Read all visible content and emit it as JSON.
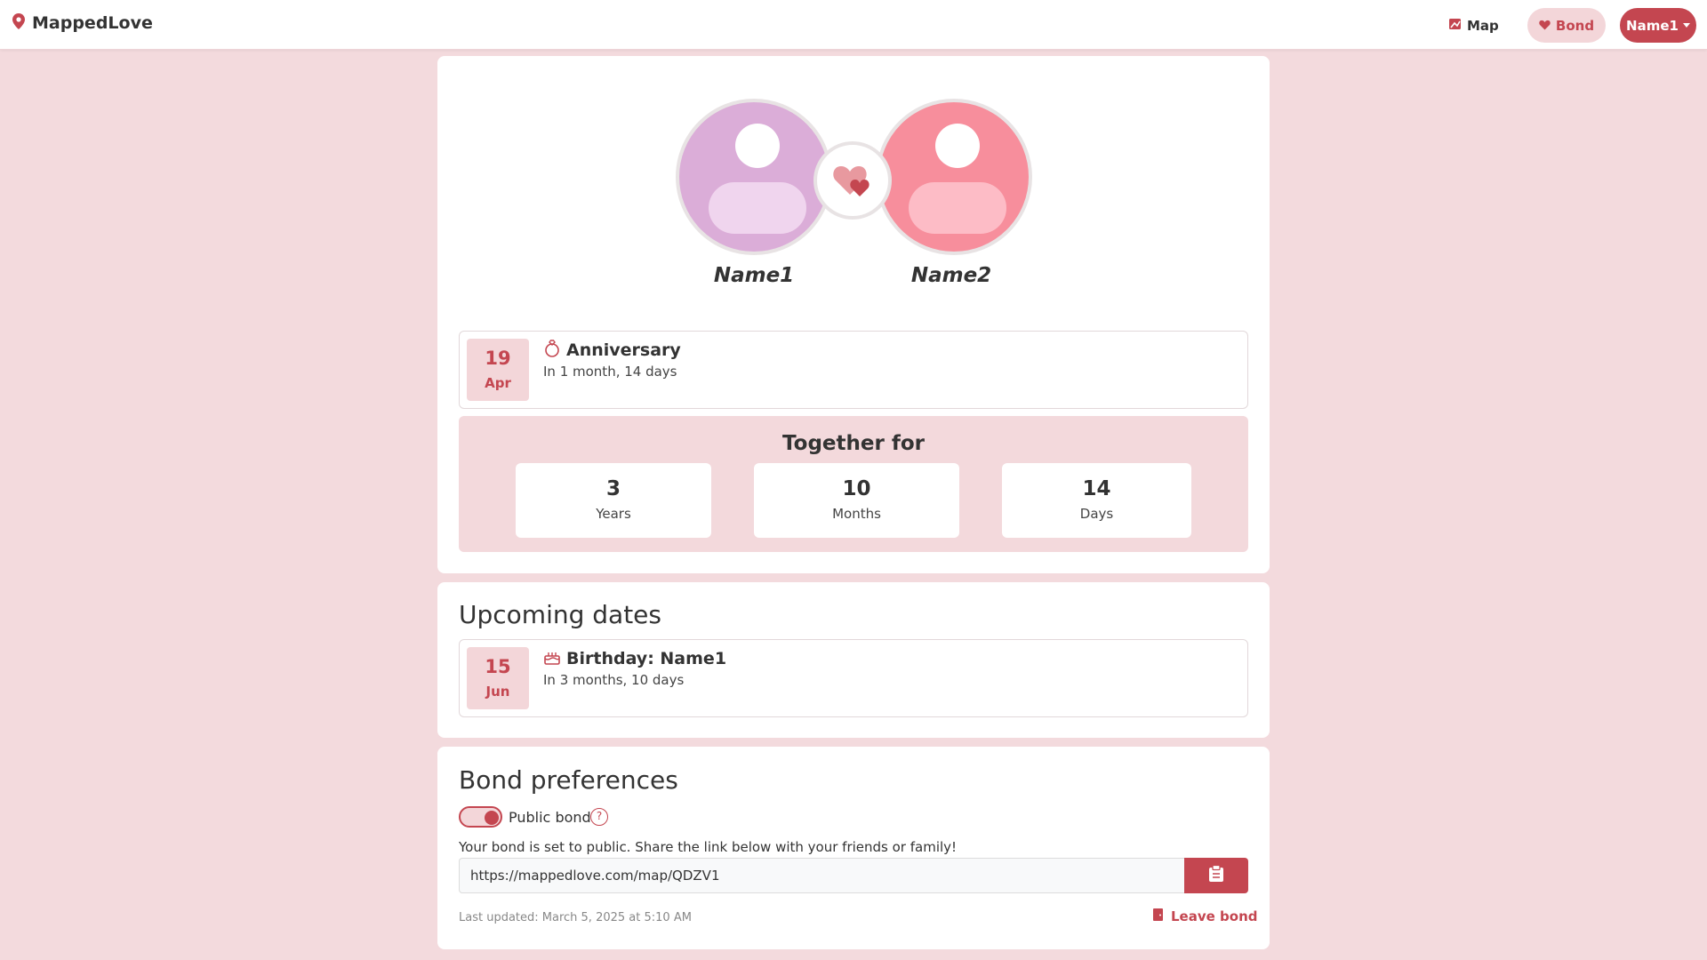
{
  "nav": {
    "brand": "MappedLove",
    "map_label": "Map",
    "bond_label": "Bond",
    "user_label": "Name1"
  },
  "couple": {
    "name1": "Name1",
    "name2": "Name2"
  },
  "anniversary": {
    "day": "19",
    "month": "Apr",
    "title": "Anniversary",
    "subtitle": "In 1 month, 14 days"
  },
  "together": {
    "title": "Together for",
    "stats": [
      {
        "value": "3",
        "label": "Years"
      },
      {
        "value": "10",
        "label": "Months"
      },
      {
        "value": "14",
        "label": "Days"
      }
    ]
  },
  "upcoming": {
    "title": "Upcoming dates",
    "events": [
      {
        "day": "15",
        "month": "Jun",
        "title": "Birthday: Name1",
        "subtitle": "In 3 months, 10 days"
      }
    ]
  },
  "preferences": {
    "title": "Bond preferences",
    "public_toggle_label": "Public bond",
    "public_enabled": true,
    "help_glyph": "?",
    "public_description": "Your bond is set to public. Share the link below with your friends or family!",
    "share_link": "https://mappedlove.com/map/QDZV1",
    "last_updated": "Last updated: March 5, 2025 at 5:10 AM",
    "leave_label": "Leave bond"
  },
  "colors": {
    "accent": "#c44650",
    "accent_light": "#f3d6d9",
    "background": "#f3dadd",
    "avatar1": "#dbadd8",
    "avatar2": "#f78e9c"
  },
  "icons": [
    "map-pin-icon",
    "map-icon",
    "heart-icon",
    "caret-down-icon",
    "hearts-icon",
    "ring-icon",
    "cake-icon",
    "help-icon",
    "clipboard-icon",
    "door-exit-icon"
  ]
}
